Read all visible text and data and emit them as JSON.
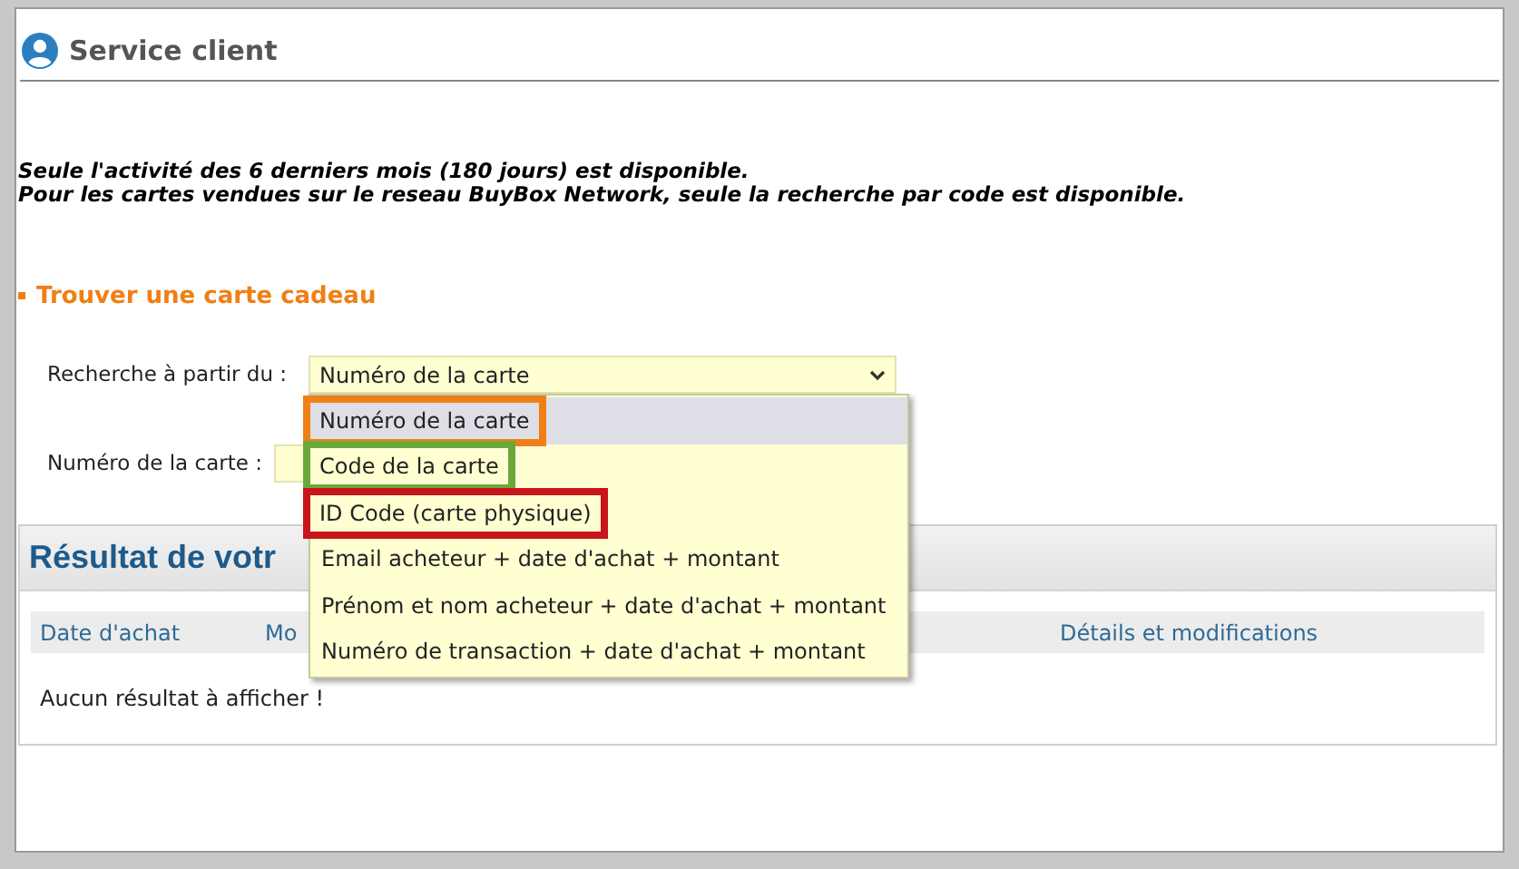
{
  "page": {
    "title": "Service client"
  },
  "notice": [
    "Seule l'activité des 6 derniers mois (180 jours) est disponible.",
    "Pour les cartes vendues sur le reseau BuyBox Network, seule la recherche par code est disponible."
  ],
  "section_title": "Trouver une carte cadeau",
  "search_by": {
    "label": "Recherche à partir du :",
    "value": "Numéro de la carte",
    "expanded": true
  },
  "card_number": {
    "label": "Numéro de la carte :"
  },
  "dropdown_options": [
    {
      "label": "Numéro de la carte",
      "selected": true,
      "color": "#f07f16"
    },
    {
      "label": "Code de la carte",
      "selected": false,
      "color": "#6aa83a"
    },
    {
      "label": "ID Code (carte physique)",
      "selected": false,
      "color": "#c8151b"
    },
    {
      "label": "Email acheteur + date d'achat + montant",
      "selected": false
    },
    {
      "label": "Prénom et nom acheteur + date d'achat + montant",
      "selected": false
    },
    {
      "label": "Numéro de transaction + date d'achat + montant",
      "selected": false
    }
  ],
  "results": {
    "title": "Résultat de votr",
    "columns": [
      "Date d'achat",
      "Mo",
      "Détails et modifications"
    ],
    "empty_message": "Aucun résultat à afficher !"
  }
}
